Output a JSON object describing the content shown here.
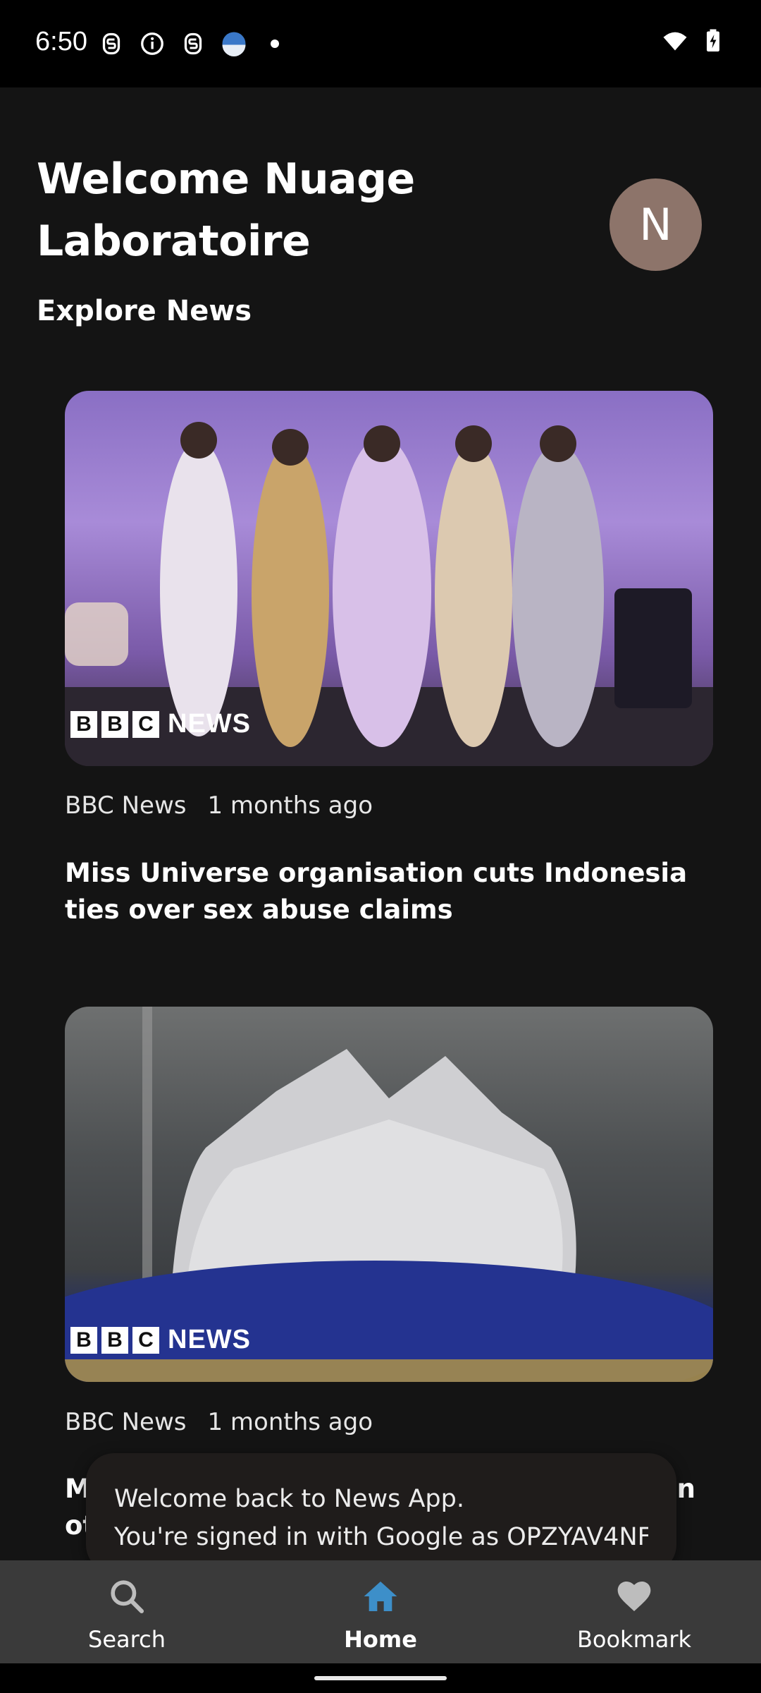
{
  "status_bar": {
    "time": "6:50",
    "left_icons": [
      "notification-s-icon",
      "info-icon",
      "notification-s-icon",
      "test-app-icon",
      "dot-icon"
    ],
    "right_icons": [
      "wifi-icon",
      "battery-charging-icon"
    ]
  },
  "header": {
    "welcome": "Welcome Nuage Laboratoire",
    "avatar_initial": "N",
    "section_title": "Explore News"
  },
  "articles": [
    {
      "source": "BBC News",
      "age": "1 months ago",
      "title": "Miss Universe organisation cuts Indonesia ties over sex abuse claims",
      "badge_letters": [
        "B",
        "B",
        "C"
      ],
      "badge_word": "NEWS"
    },
    {
      "source": "BBC News",
      "age": "1 months ago",
      "title": "M",
      "title_line2": "ot",
      "title_tail": "in",
      "badge_letters": [
        "B",
        "B",
        "C"
      ],
      "badge_word": "NEWS"
    }
  ],
  "snackbar": {
    "line1": "Welcome back to News App.",
    "line2": "You're signed in with Google as OPZYAV4NF..."
  },
  "bottom_nav": {
    "items": [
      {
        "label": "Search",
        "icon": "search-icon",
        "active": false
      },
      {
        "label": "Home",
        "icon": "home-icon",
        "active": true
      },
      {
        "label": "Bookmark",
        "icon": "heart-icon",
        "active": false
      }
    ]
  },
  "colors": {
    "background": "#141414",
    "avatar": "#8d746a",
    "nav_active_icon": "#3d8fc9",
    "nav_background": "#3a3a3a"
  }
}
